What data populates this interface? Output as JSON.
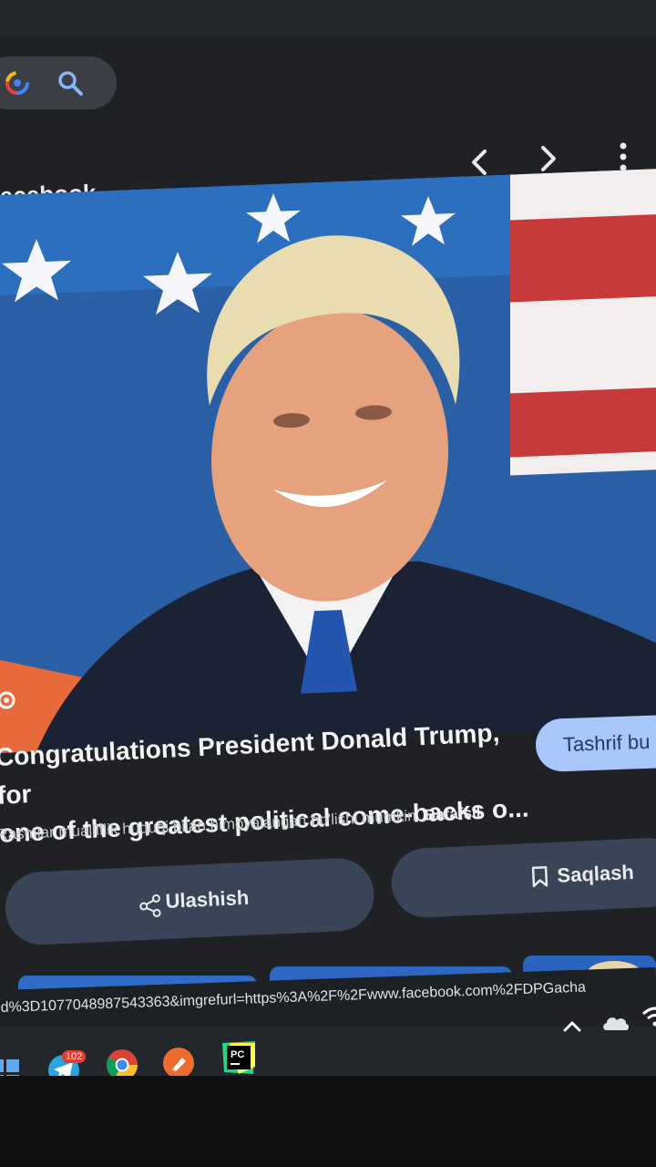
{
  "header": {
    "source_name": "acebook",
    "icons": [
      "google-lens-icon",
      "search-icon",
      "chevron-left-icon",
      "chevron-right-icon",
      "more-vert-icon"
    ]
  },
  "preview": {
    "description_icon": "image-search-icon"
  },
  "result": {
    "visit_label": "Tashrif bu",
    "title": "Congratulations President Donald Trump, for\none of the greatest political come-backs o...",
    "copyright_text": "Rasmlar mualliflik huquqi bilan himoyalangan bo'lishi mumkin.",
    "more_link": "Batafsil"
  },
  "actions": {
    "share_label": "Ulashish",
    "save_label": "Saqlash"
  },
  "statusbar": {
    "url": "d%3D1077048987543363&imgrefurl=https%3A%2F%2Fwww.facebook.com%2FDPGacha"
  },
  "taskbar": {
    "telegram_badge": "102",
    "apps": [
      "windows-start-icon",
      "telegram-icon",
      "chrome-icon",
      "postman-icon",
      "pycharm-icon"
    ],
    "pycharm_label": "PC"
  },
  "colors": {
    "accent": "#a8c7fa",
    "button_bg": "#394457",
    "screen_bg": "#1f2124"
  }
}
